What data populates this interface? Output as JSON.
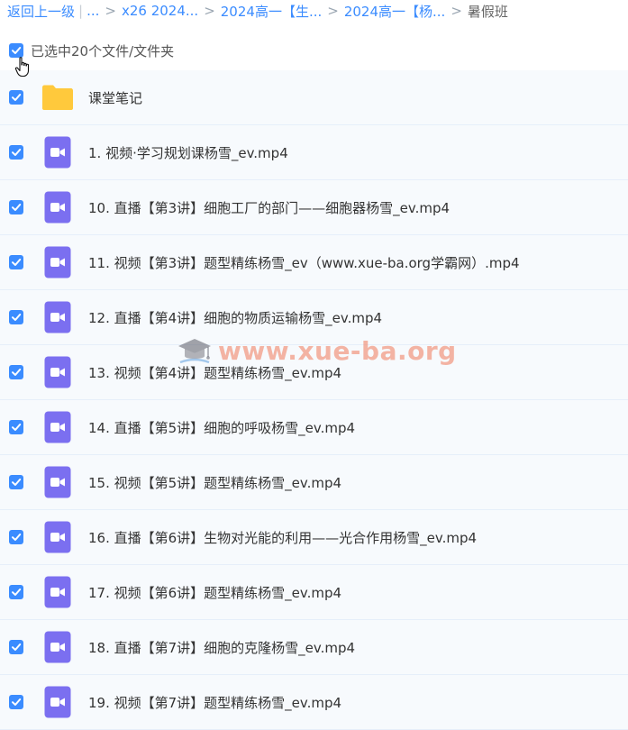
{
  "breadcrumb": {
    "back": "返回上一级",
    "ellipsis": "...",
    "items": [
      "x26 2024...",
      "2024高一【生...",
      "2024高一【杨...",
      "暑假班"
    ]
  },
  "selection": {
    "text": "已选中20个文件/文件夹"
  },
  "files": [
    {
      "name": "课堂笔记",
      "type": "folder"
    },
    {
      "name": "1. 视频·学习规划课杨雪_ev.mp4",
      "type": "video"
    },
    {
      "name": "10. 直播【第3讲】细胞工厂的部门——细胞器杨雪_ev.mp4",
      "type": "video"
    },
    {
      "name": "11. 视频【第3讲】题型精练杨雪_ev（www.xue-ba.org学霸网）.mp4",
      "type": "video"
    },
    {
      "name": "12. 直播【第4讲】细胞的物质运输杨雪_ev.mp4",
      "type": "video"
    },
    {
      "name": "13. 视频【第4讲】题型精练杨雪_ev.mp4",
      "type": "video"
    },
    {
      "name": "14. 直播【第5讲】细胞的呼吸杨雪_ev.mp4",
      "type": "video"
    },
    {
      "name": "15. 视频【第5讲】题型精练杨雪_ev.mp4",
      "type": "video"
    },
    {
      "name": "16. 直播【第6讲】生物对光能的利用——光合作用杨雪_ev.mp4",
      "type": "video"
    },
    {
      "name": "17. 视频【第6讲】题型精练杨雪_ev.mp4",
      "type": "video"
    },
    {
      "name": "18. 直播【第7讲】细胞的克隆杨雪_ev.mp4",
      "type": "video"
    },
    {
      "name": "19. 视频【第7讲】题型精练杨雪_ev.mp4",
      "type": "video"
    }
  ],
  "watermark": {
    "text": "www.xue-ba.org",
    "icon": "graduation-cap-icon"
  },
  "colors": {
    "accent": "#3b8cff",
    "video_icon": "#7b6ff0",
    "folder_icon": "#ffc93c"
  }
}
